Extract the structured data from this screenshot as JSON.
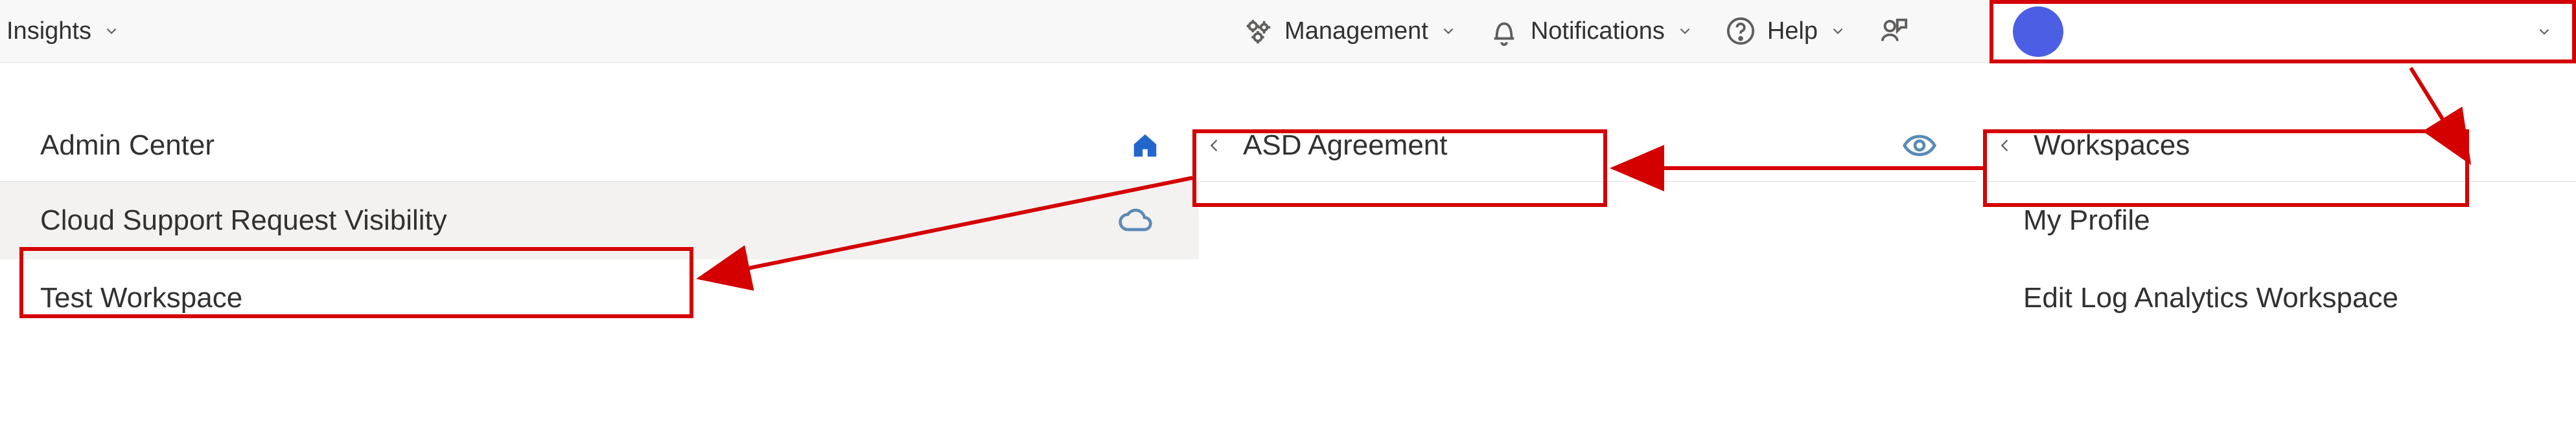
{
  "topbar": {
    "insights_label": "Insights",
    "management_label": "Management",
    "notifications_label": "Notifications",
    "help_label": "Help"
  },
  "colors": {
    "highlight": "#d40000",
    "avatar": "#4b5ee4"
  },
  "left_panel": {
    "header": "Admin Center",
    "items": [
      {
        "label": "Cloud Support Request Visibility",
        "icon": "cloud"
      },
      {
        "label": "Test Workspace"
      }
    ]
  },
  "mid_panel": {
    "header": "ASD Agreement"
  },
  "right_panel": {
    "header": "Workspaces",
    "items": [
      {
        "label": "My Profile"
      },
      {
        "label": "Edit Log Analytics Workspace"
      }
    ]
  }
}
